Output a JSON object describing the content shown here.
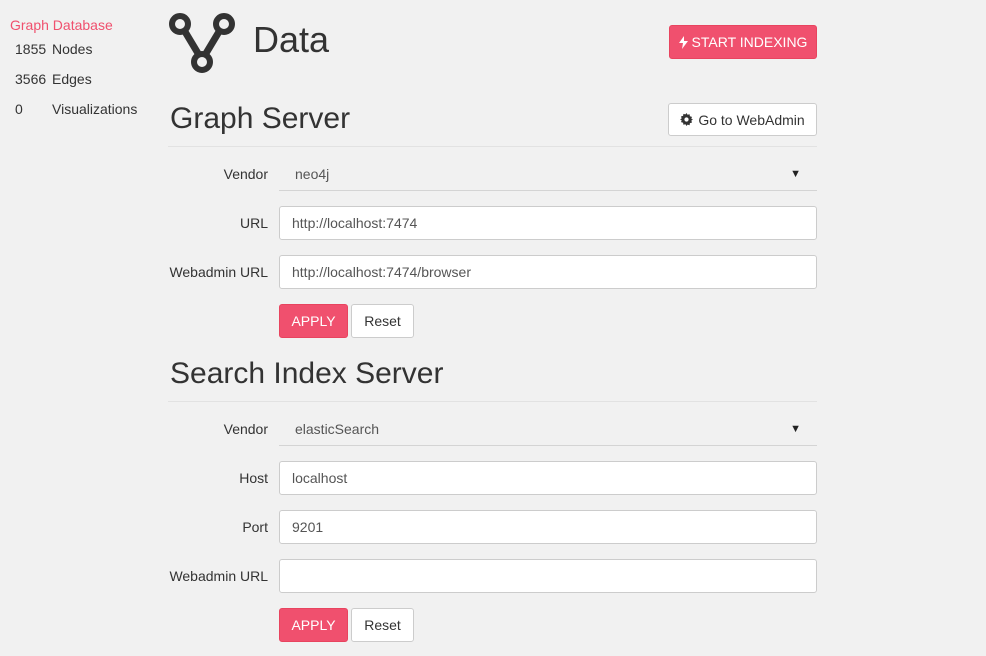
{
  "sidebar": {
    "title": "Graph Database",
    "stats": [
      {
        "value": "1855",
        "label": "Nodes"
      },
      {
        "value": "3566",
        "label": "Edges"
      },
      {
        "value": "0",
        "label": "Visualizations"
      }
    ]
  },
  "header": {
    "title": "Data",
    "start_indexing_label": "START INDEXING",
    "icons": {
      "logo": "graph-nodes-icon",
      "bolt": "bolt-icon"
    }
  },
  "graph_server": {
    "title": "Graph Server",
    "webadmin_button": "Go to WebAdmin",
    "vendor_label": "Vendor",
    "vendor_value": "neo4j",
    "url_label": "URL",
    "url_value": "http://localhost:7474",
    "webadmin_url_label": "Webadmin URL",
    "webadmin_url_value": "http://localhost:7474/browser",
    "apply_label": "APPLY",
    "reset_label": "Reset"
  },
  "search_server": {
    "title": "Search Index Server",
    "vendor_label": "Vendor",
    "vendor_value": "elasticSearch",
    "host_label": "Host",
    "host_value": "localhost",
    "port_label": "Port",
    "port_value": "9201",
    "webadmin_url_label": "Webadmin URL",
    "webadmin_url_value": "",
    "apply_label": "APPLY",
    "reset_label": "Reset"
  },
  "colors": {
    "accent": "#f0506e",
    "background": "#f1f1f1"
  }
}
